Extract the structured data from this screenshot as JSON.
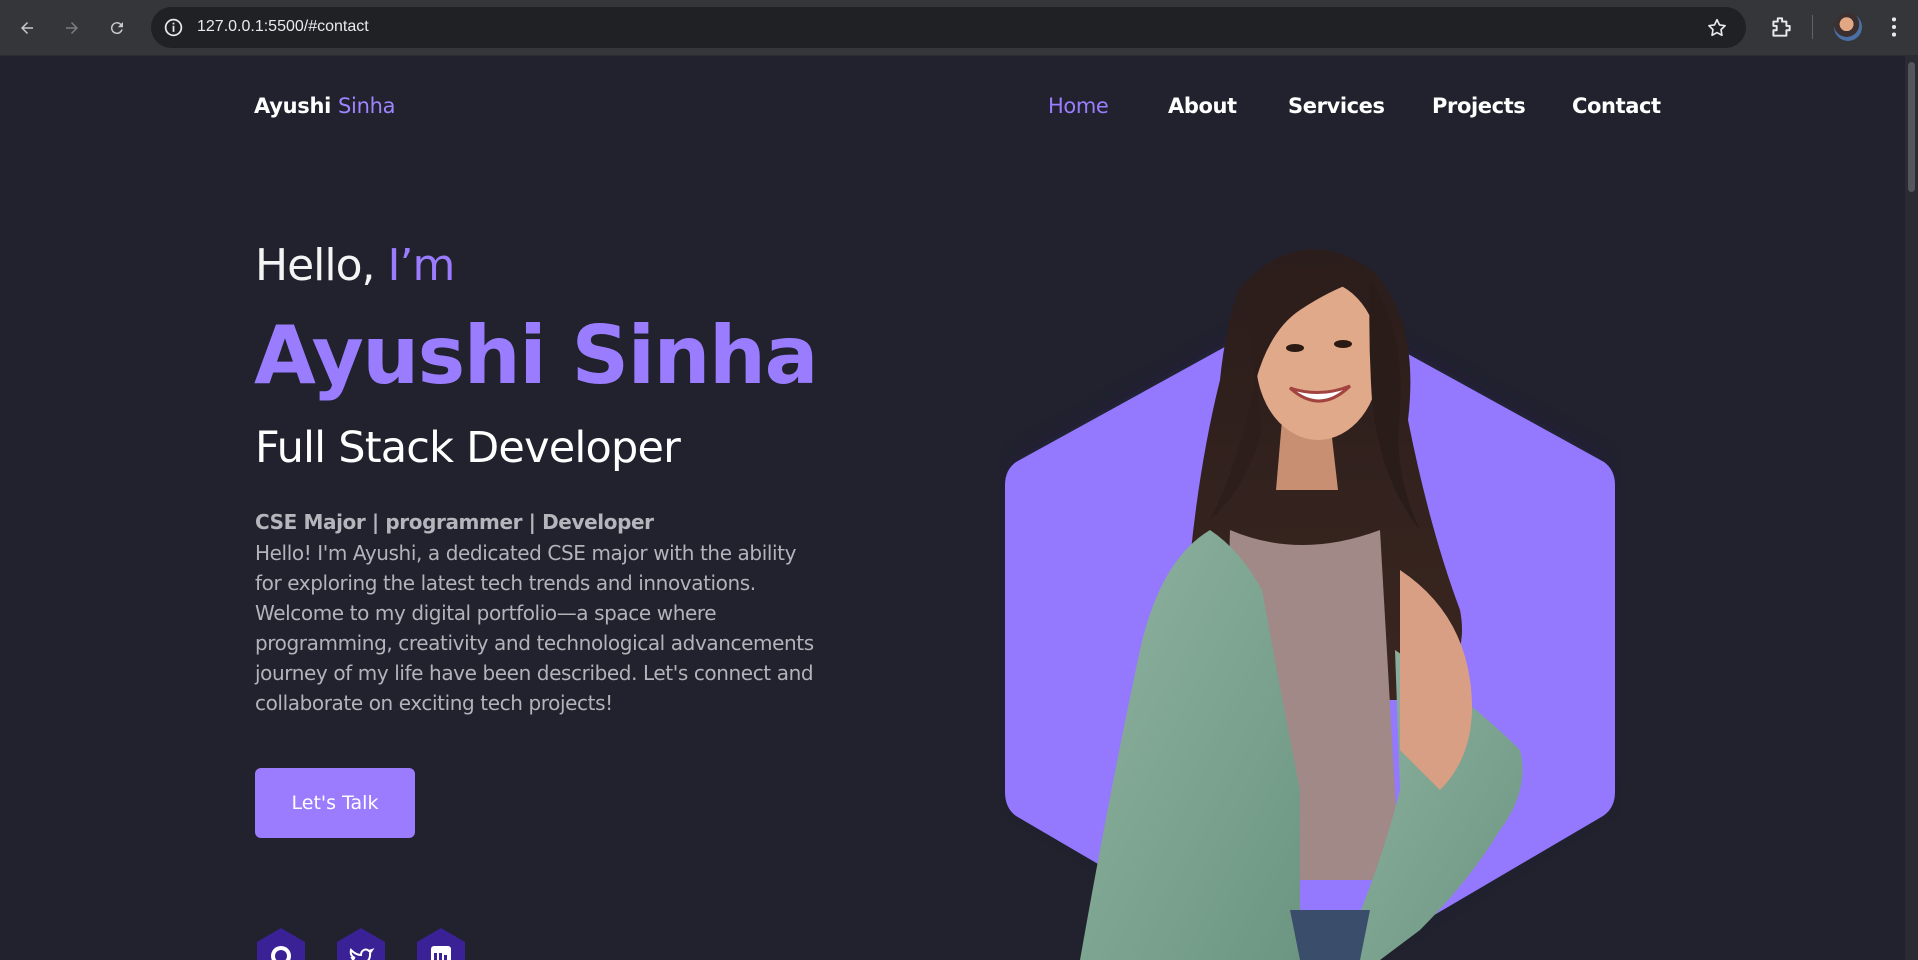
{
  "browser": {
    "url": "127.0.0.1:5500/#contact",
    "icons": [
      "back-arrow-icon",
      "forward-arrow-icon",
      "reload-icon",
      "site-info-icon",
      "bookmark-star-icon",
      "extensions-icon",
      "profile-avatar",
      "menu-dots-icon"
    ]
  },
  "site": {
    "logo_first": "Ayushi",
    "logo_last": "Sinha",
    "nav": [
      {
        "label": "Home",
        "active": true
      },
      {
        "label": "About",
        "active": false
      },
      {
        "label": "Services",
        "active": false
      },
      {
        "label": "Projects",
        "active": false
      },
      {
        "label": "Contact",
        "active": false
      }
    ],
    "hero": {
      "greeting": "Hello,",
      "greeting_accent": "I’m",
      "name": "Ayushi Sinha",
      "role": "Full Stack Developer",
      "tagline": "CSE Major | programmer | Developer",
      "bio": "Hello! I'm Ayushi, a dedicated CSE major with the ability for exploring the latest tech trends and innovations. Welcome to my digital portfolio—a space where programming, creativity and technological advancements journey of my life have been described. Let's connect and collaborate on exciting tech projects!",
      "cta_label": "Let's Talk"
    },
    "social": [
      "github-icon",
      "twitter-icon",
      "linkedin-icon"
    ]
  },
  "colors": {
    "background": "#21222d",
    "accent": "#9b7cff",
    "social_bg": "#3a2296"
  }
}
